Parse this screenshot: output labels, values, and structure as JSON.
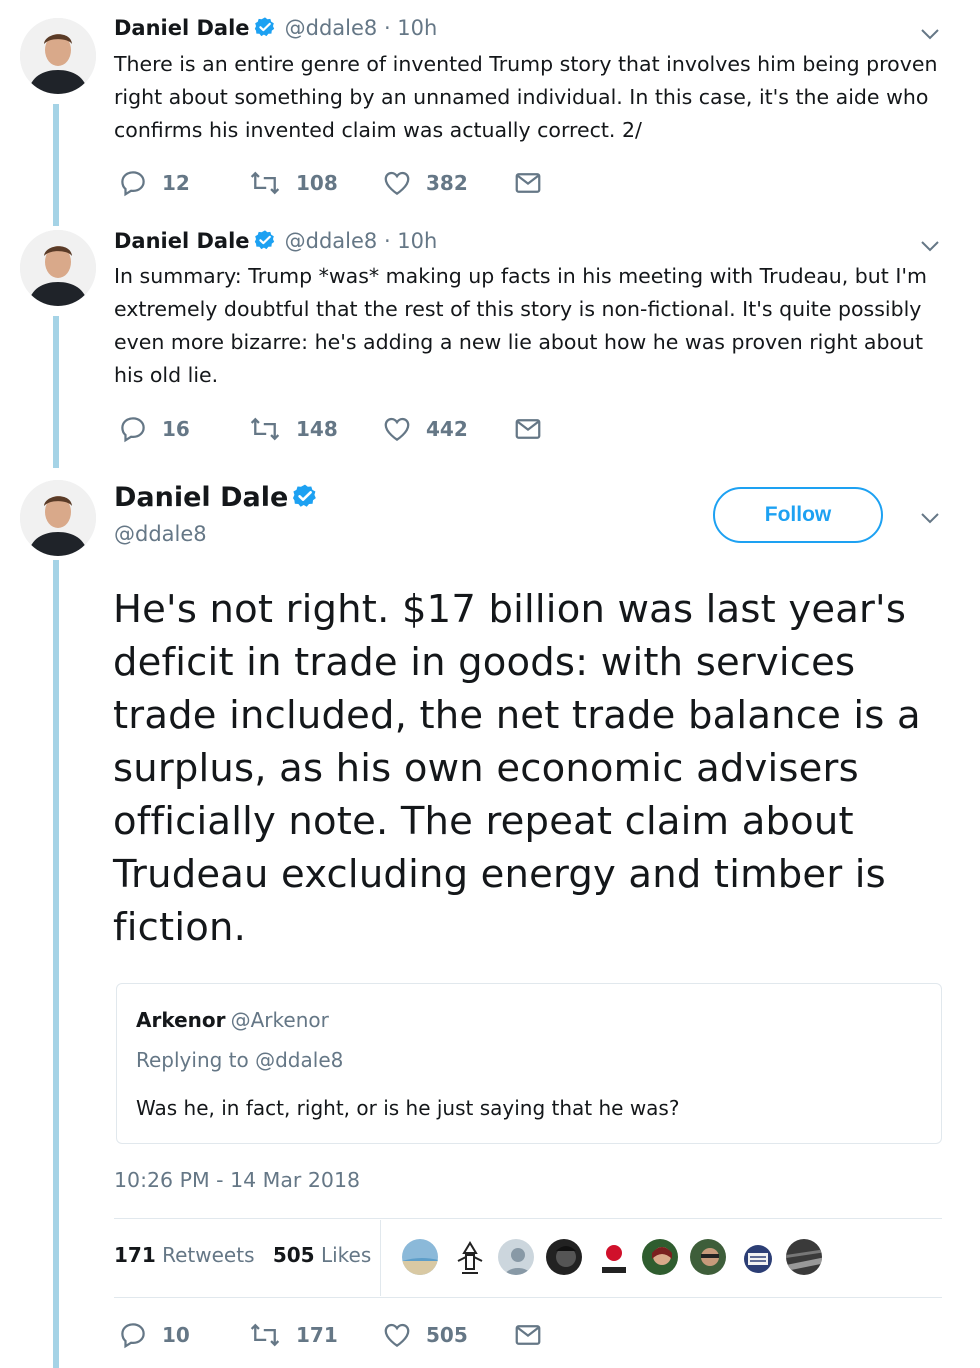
{
  "tweets": [
    {
      "name": "Daniel Dale",
      "handle": "@ddale8 · 10h",
      "text": "There is an entire genre of invented Trump story that involves him being proven right about something by an unnamed individual. In this case, it's the aide who confirms his invented claim was actually correct. 2/",
      "replies": "12",
      "retweets": "108",
      "likes": "382"
    },
    {
      "name": "Daniel Dale",
      "handle": "@ddale8 · 10h",
      "text": "In summary: Trump *was* making up facts in his meeting with Trudeau, but I'm extremely doubtful that the rest of this story is non-fictional. It's quite possibly even more bizarre: he's adding a new lie about how he was proven right about his old lie.",
      "replies": "16",
      "retweets": "148",
      "likes": "442"
    }
  ],
  "main_tweet": {
    "name": "Daniel Dale",
    "handle": "@ddale8",
    "follow_label": "Follow",
    "text": "He's not right. $17 billion was last year's deficit in trade in goods: with services trade included, the net trade balance is a surplus, as his own economic advisers officially note. The repeat claim about Trudeau excluding energy and timber is fiction.",
    "quoted": {
      "name": "Arkenor",
      "handle": "@Arkenor",
      "replying_to": "Replying to @ddale8",
      "text": "Was he, in fact, right, or is he just saying that he was?"
    },
    "timestamp": "10:26 PM - 14 Mar 2018",
    "stats": {
      "retweets_count": "171",
      "retweets_label": "Retweets",
      "likes_count": "505",
      "likes_label": "Likes"
    },
    "replies": "10",
    "retweets": "171",
    "likes": "505"
  },
  "colors": {
    "accent": "#1da1f2",
    "thread_line": "#a5d3e6",
    "muted_text": "#657786"
  },
  "icons": [
    "verified-badge-icon",
    "chevron-down-icon",
    "reply-icon",
    "retweet-icon",
    "like-icon",
    "direct-message-icon"
  ]
}
